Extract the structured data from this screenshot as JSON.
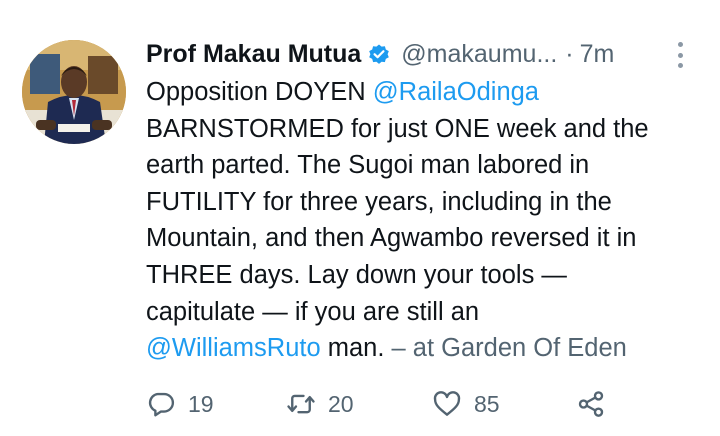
{
  "tweet": {
    "author_name": "Prof Makau Mutua",
    "handle": "@makaumu...",
    "separator": "·",
    "time": "7m",
    "text": {
      "line1": "Opposition DOYEN ",
      "mention1": "@RailaOdinga",
      "line2": "BARNSTORMED for just ONE week and the",
      "line3": "earth parted.  The Sugoi man labored in",
      "line4": "FUTILITY for three years, including in the",
      "line5": "Mountain, and then Agwambo reversed it in",
      "line6": "THREE days. Lay down your tools —",
      "line7": "capitulate — if you are still an",
      "mention2": "@WilliamsRuto",
      "line8_rest": " man.",
      "location": " – at Garden Of Eden"
    },
    "actions": {
      "reply_count": "19",
      "retweet_count": "20",
      "like_count": "85"
    },
    "colors": {
      "link": "#1d9bf0",
      "secondary_text": "#536471",
      "verified_badge": "#1d9bf0"
    },
    "icons": [
      "verified-badge-icon",
      "more-options-icon",
      "reply-icon",
      "retweet-icon",
      "like-icon",
      "share-icon"
    ]
  }
}
